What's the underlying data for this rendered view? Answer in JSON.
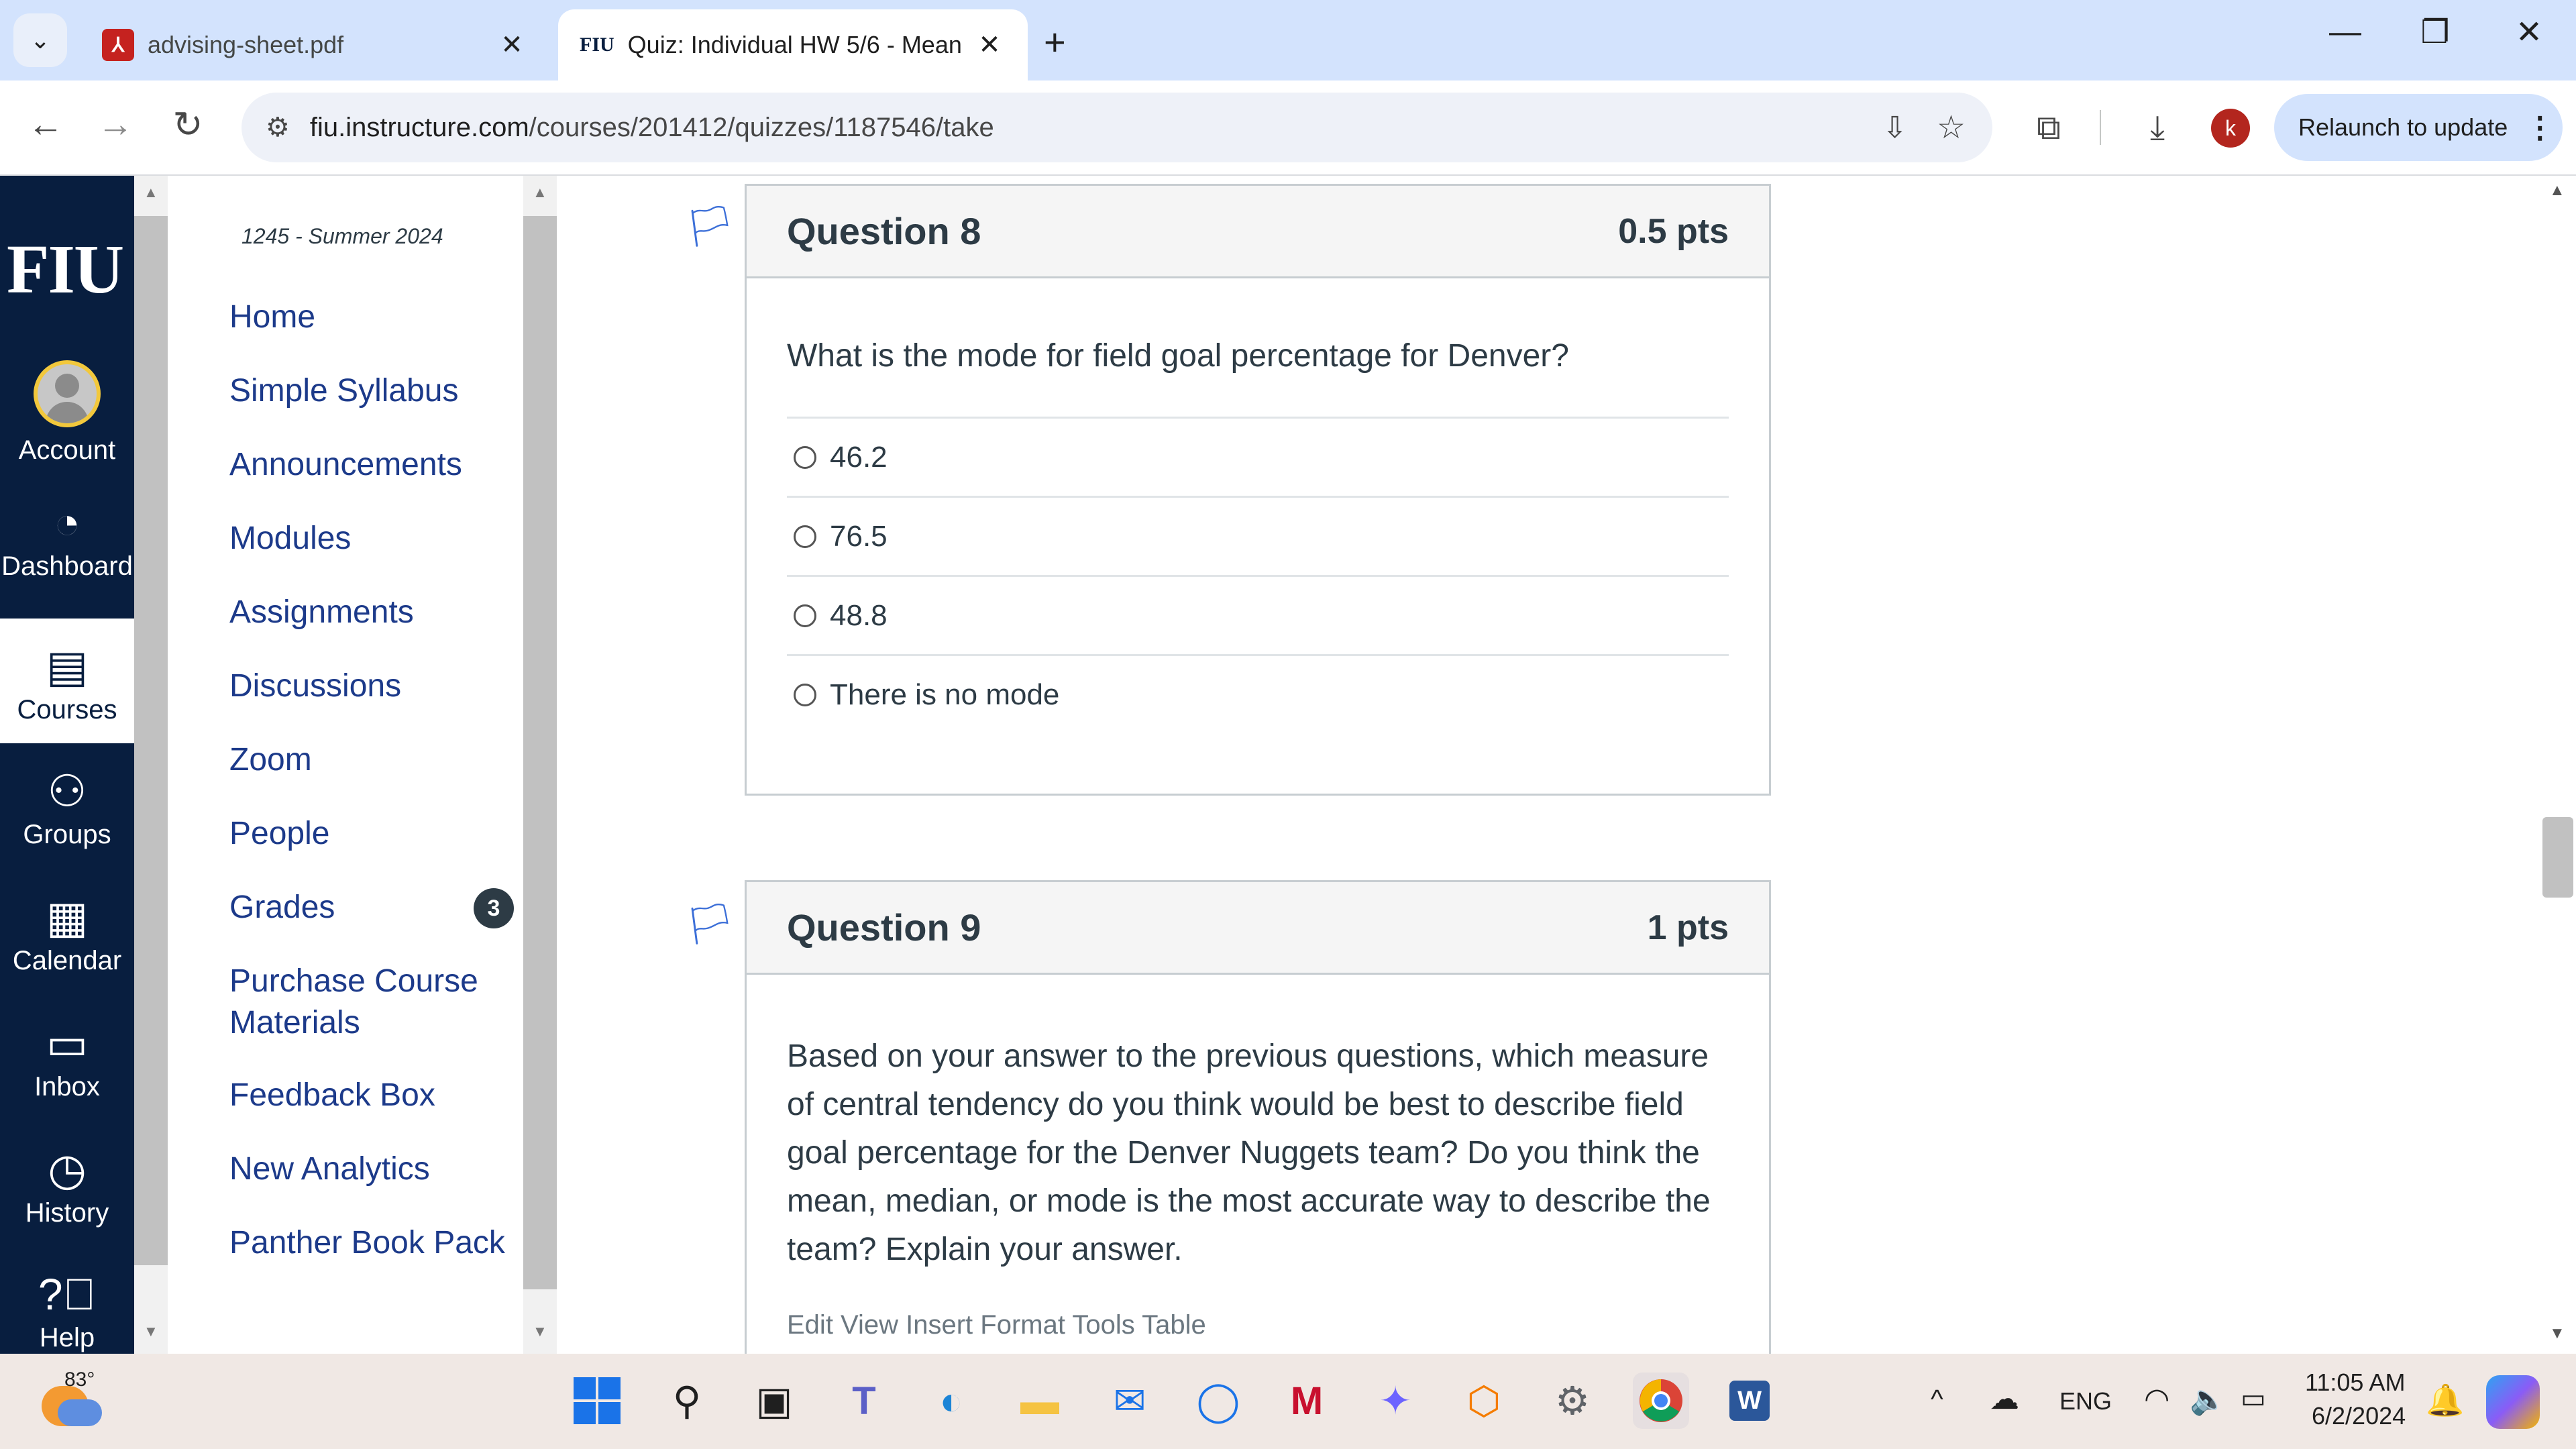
{
  "browser": {
    "tabs": [
      {
        "title": "advising-sheet.pdf",
        "icon": "pdf-icon",
        "active": false
      },
      {
        "title": "Quiz: Individual HW 5/6 - Mean",
        "icon": "fiu-favicon",
        "active": true
      }
    ],
    "url_host": "fiu.instructure.com",
    "url_path": "/courses/201412/quizzes/1187546/take",
    "profile_initial": "k",
    "relaunch_label": "Relaunch to update"
  },
  "global_nav": {
    "logo": "FIU",
    "items": [
      {
        "label": "Account",
        "icon": "avatar"
      },
      {
        "label": "Dashboard",
        "icon": "dashboard-icon"
      },
      {
        "label": "Courses",
        "icon": "courses-icon",
        "active": true
      },
      {
        "label": "Groups",
        "icon": "groups-icon"
      },
      {
        "label": "Calendar",
        "icon": "calendar-icon"
      },
      {
        "label": "Inbox",
        "icon": "inbox-icon"
      },
      {
        "label": "History",
        "icon": "history-icon"
      },
      {
        "label": "Help",
        "icon": "help-icon"
      }
    ]
  },
  "course_nav": {
    "term": "1245 - Summer 2024",
    "links": [
      {
        "label": "Home"
      },
      {
        "label": "Simple Syllabus"
      },
      {
        "label": "Announcements"
      },
      {
        "label": "Modules"
      },
      {
        "label": "Assignments"
      },
      {
        "label": "Discussions"
      },
      {
        "label": "Zoom"
      },
      {
        "label": "People"
      },
      {
        "label": "Grades",
        "badge": "3"
      },
      {
        "label": "Purchase Course Materials"
      },
      {
        "label": "Feedback Box"
      },
      {
        "label": "New Analytics"
      },
      {
        "label": "Panther Book Pack"
      }
    ]
  },
  "quiz": {
    "q8": {
      "title": "Question 8",
      "points": "0.5 pts",
      "text": "What is the mode for field goal percentage for Denver?",
      "answers": [
        "46.2",
        "76.5",
        "48.8",
        "There is no mode"
      ]
    },
    "q9": {
      "title": "Question 9",
      "points": "1 pts",
      "text": "Based on your answer to the previous questions, which measure of central tendency do you think would be best to describe field goal percentage for the Denver Nuggets team? Do you think the mean, median, or mode is the most accurate way to describe the team? Explain your answer.",
      "editor_menu": "Edit   View   Insert   Format   Tools   Table"
    }
  },
  "taskbar": {
    "weather_temp": "83°",
    "language": "ENG",
    "time": "11:05 AM",
    "date": "6/2/2024"
  }
}
